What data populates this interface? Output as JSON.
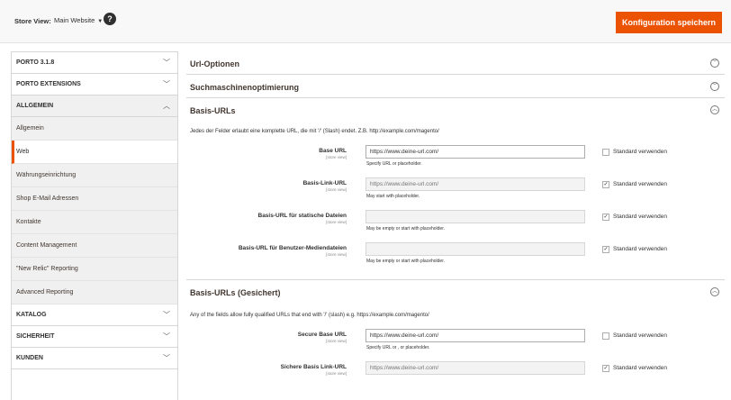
{
  "header": {
    "store_view_label": "Store View:",
    "store_view_value": "Main Website",
    "help_icon": "?",
    "save_label": "Konfiguration speichern",
    "accent_color": "#eb5202"
  },
  "sidebar": {
    "sections": [
      {
        "label": "PORTO 3.1.8",
        "chevron": "﹀"
      },
      {
        "label": "PORTO EXTENSIONS",
        "chevron": "﹀"
      },
      {
        "label": "ALLGEMEIN",
        "chevron": "︿"
      }
    ],
    "items": [
      {
        "label": "Allgemein"
      },
      {
        "label": "Web"
      },
      {
        "label": "Währungseinrichtung"
      },
      {
        "label": "Shop E-Mail Adressen"
      },
      {
        "label": "Kontakte"
      },
      {
        "label": "Content Management"
      },
      {
        "label": "\"New Relic\" Reporting"
      },
      {
        "label": "Advanced Reporting"
      }
    ],
    "sections_after": [
      {
        "label": "KATALOG",
        "chevron": "﹀"
      },
      {
        "label": "SICHERHEIT",
        "chevron": "﹀"
      },
      {
        "label": "KUNDEN",
        "chevron": "﹀"
      }
    ]
  },
  "main": {
    "url_options": {
      "title": "Url-Optionen",
      "toggle": "﹀"
    },
    "seo": {
      "title": "Suchmaschinenoptimierung",
      "toggle": "﹀"
    },
    "base_urls": {
      "title": "Basis-URLs",
      "toggle": "︿",
      "description": "Jedes der Felder erlaubt eine komplette URL, die mit '/' (Slash) endet. Z.B. http://example.com/magento/",
      "fields": [
        {
          "label": "Base URL",
          "scope": "[store view]",
          "value": "https://www.deine-url.com/",
          "placeholder": "",
          "note": "Specify URL or placeholder.",
          "checkbox_label": "Standard verwenden",
          "check": ""
        },
        {
          "label": "Basis-Link-URL",
          "scope": "[store view]",
          "value": "",
          "placeholder": "https://www.deine-url.com/",
          "note": "May start with placeholder.",
          "checkbox_label": "Standard verwenden",
          "check": "✓"
        },
        {
          "label": "Basis-URL für statische Dateien",
          "scope": "[store view]",
          "value": "",
          "placeholder": "",
          "note": "May be empty or start with placeholder.",
          "checkbox_label": "Standard verwenden",
          "check": "✓"
        },
        {
          "label": "Basis-URL für Benutzer-Mediendateien",
          "scope": "[store view]",
          "value": "",
          "placeholder": "",
          "note": "May be empty or start with placeholder.",
          "checkbox_label": "Standard verwenden",
          "check": "✓"
        }
      ]
    },
    "secure_urls": {
      "title": "Basis-URLs (Gesichert)",
      "toggle": "︿",
      "description": "Any of the fields allow fully qualified URLs that end with '/' (slash) e.g. https://example.com/magento/",
      "fields": [
        {
          "label": "Secure Base URL",
          "scope": "[store view]",
          "value": "https://www.deine-url.com/",
          "placeholder": "",
          "note": "Specify URL or , or placeholder.",
          "checkbox_label": "Standard verwenden",
          "check": ""
        },
        {
          "label": "Sichere Basis Link-URL",
          "scope": "[store view]",
          "value": "",
          "placeholder": "https://www.deine-url.com/",
          "note": "",
          "checkbox_label": "Standard verwenden",
          "check": "✓"
        }
      ]
    }
  }
}
